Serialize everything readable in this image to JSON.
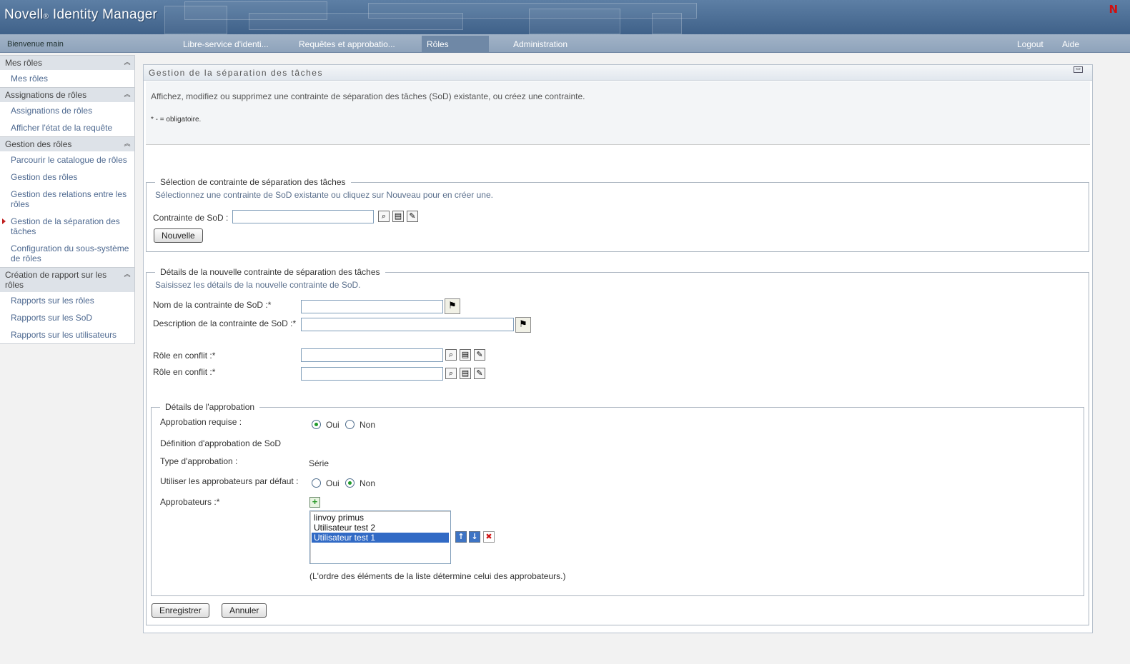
{
  "header": {
    "brand": "Novell",
    "brand_reg": "®",
    "product": " Identity Manager",
    "logo_letter": "N"
  },
  "nav": {
    "welcome": "Bienvenue main",
    "tabs": [
      {
        "label": "Libre-service d'identi..."
      },
      {
        "label": "Requêtes et approbatio..."
      },
      {
        "label": "Rôles",
        "active": true
      },
      {
        "label": "Administration"
      }
    ],
    "logout": "Logout",
    "help": "Aide"
  },
  "sidebar": {
    "sections": [
      {
        "title": "Mes rôles",
        "items": [
          "Mes rôles"
        ]
      },
      {
        "title": "Assignations de rôles",
        "items": [
          "Assignations de rôles",
          "Afficher l'état de la requête"
        ]
      },
      {
        "title": "Gestion des rôles",
        "items": [
          "Parcourir le catalogue de rôles",
          "Gestion des rôles",
          "Gestion des relations entre les rôles",
          "Gestion de la séparation des tâches",
          "Configuration du sous-système de rôles"
        ]
      },
      {
        "title": "Création de rapport sur les rôles",
        "items": [
          "Rapports sur les rôles",
          "Rapports sur les SoD",
          "Rapports sur les utilisateurs"
        ]
      }
    ],
    "current_item": "Gestion de la séparation des tâches"
  },
  "panel": {
    "title": "Gestion de la séparation des tâches",
    "intro": "Affichez, modifiez ou supprimez une contrainte de séparation des tâches (SoD) existante, ou créez une contrainte.",
    "required_note": "* - = obligatoire."
  },
  "selection": {
    "legend": "Sélection de contrainte de séparation des tâches",
    "hint": "Sélectionnez une contrainte de SoD existante ou cliquez sur Nouveau pour en créer une.",
    "field_label": "Contrainte de SoD :",
    "field_value": "",
    "new_button": "Nouvelle"
  },
  "details": {
    "legend": "Détails de la nouvelle contrainte de séparation des tâches",
    "hint": "Saisissez les détails de la nouvelle contrainte de SoD.",
    "name_label": "Nom de la contrainte de SoD :*",
    "name_value": "",
    "desc_label": "Description de la contrainte de SoD :*",
    "desc_value": "",
    "conflict_label_1": "Rôle en conflit :*",
    "conflict_value_1": "",
    "conflict_label_2": "Rôle en conflit :*",
    "conflict_value_2": ""
  },
  "approval": {
    "legend": "Détails de l'approbation",
    "required_label": "Approbation requise :",
    "yes": "Oui",
    "no": "Non",
    "required_value": "Oui",
    "definition_label": "Définition d'approbation de SoD",
    "type_label": "Type d'approbation :",
    "type_value": "Série",
    "default_label": "Utiliser les approbateurs par défaut :",
    "default_value": "Non",
    "approvers_label": "Approbateurs :*",
    "approvers": [
      "linvoy primus",
      "Utilisateur test 2",
      "Utilisateur test 1"
    ],
    "selected_approver": "Utilisateur test 1",
    "order_note": "(L'ordre des éléments de la liste détermine celui des approbateurs.)"
  },
  "actions": {
    "save": "Enregistrer",
    "cancel": "Annuler"
  }
}
